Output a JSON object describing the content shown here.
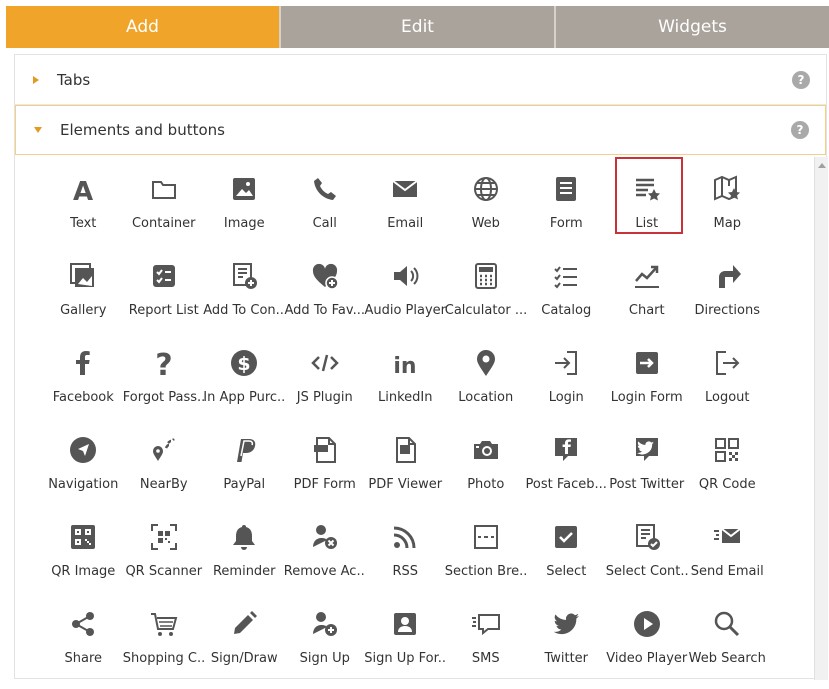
{
  "tabs": [
    {
      "label": "Add",
      "active": true
    },
    {
      "label": "Edit",
      "active": false
    },
    {
      "label": "Widgets",
      "active": false
    }
  ],
  "sections": {
    "tabs": {
      "label": "Tabs",
      "help": "?"
    },
    "elements": {
      "label": "Elements and buttons",
      "help": "?"
    }
  },
  "colors": {
    "accent": "#f0a52a",
    "icon": "#555555",
    "highlight": "#c8323a"
  },
  "items": [
    {
      "label": "Text",
      "icon": "text-icon"
    },
    {
      "label": "Container",
      "icon": "folder-icon"
    },
    {
      "label": "Image",
      "icon": "image-icon"
    },
    {
      "label": "Call",
      "icon": "phone-icon"
    },
    {
      "label": "Email",
      "icon": "envelope-icon"
    },
    {
      "label": "Web",
      "icon": "globe-icon"
    },
    {
      "label": "Form",
      "icon": "form-icon"
    },
    {
      "label": "List",
      "icon": "list-star-icon",
      "selected": true
    },
    {
      "label": "Map",
      "icon": "map-star-icon"
    },
    {
      "label": "Gallery",
      "icon": "gallery-icon"
    },
    {
      "label": "Report List",
      "icon": "report-list-icon"
    },
    {
      "label": "Add To Con...",
      "icon": "add-to-contacts-icon"
    },
    {
      "label": "Add To Fav...",
      "icon": "add-to-favorites-icon"
    },
    {
      "label": "Audio Player",
      "icon": "speaker-icon"
    },
    {
      "label": "Calculator ...",
      "icon": "calculator-icon"
    },
    {
      "label": "Catalog",
      "icon": "catalog-icon"
    },
    {
      "label": "Chart",
      "icon": "chart-icon"
    },
    {
      "label": "Directions",
      "icon": "directions-icon"
    },
    {
      "label": "Facebook",
      "icon": "facebook-icon"
    },
    {
      "label": "Forgot Pass...",
      "icon": "question-icon"
    },
    {
      "label": "In App Purc...",
      "icon": "dollar-icon"
    },
    {
      "label": "JS Plugin",
      "icon": "code-icon"
    },
    {
      "label": "LinkedIn",
      "icon": "linkedin-icon"
    },
    {
      "label": "Location",
      "icon": "location-pin-icon"
    },
    {
      "label": "Login",
      "icon": "login-icon"
    },
    {
      "label": "Login Form",
      "icon": "login-form-icon"
    },
    {
      "label": "Logout",
      "icon": "logout-icon"
    },
    {
      "label": "Navigation",
      "icon": "navigation-icon"
    },
    {
      "label": "NearBy",
      "icon": "nearby-icon"
    },
    {
      "label": "PayPal",
      "icon": "paypal-icon"
    },
    {
      "label": "PDF Form",
      "icon": "pdf-form-icon"
    },
    {
      "label": "PDF Viewer",
      "icon": "pdf-viewer-icon"
    },
    {
      "label": "Photo",
      "icon": "camera-icon"
    },
    {
      "label": "Post Faceb...",
      "icon": "post-facebook-icon"
    },
    {
      "label": "Post Twitter",
      "icon": "post-twitter-icon"
    },
    {
      "label": "QR Code",
      "icon": "qr-code-icon"
    },
    {
      "label": "QR Image",
      "icon": "qr-image-icon"
    },
    {
      "label": "QR Scanner",
      "icon": "qr-scanner-icon"
    },
    {
      "label": "Reminder",
      "icon": "bell-icon"
    },
    {
      "label": "Remove Ac...",
      "icon": "remove-account-icon"
    },
    {
      "label": "RSS",
      "icon": "rss-icon"
    },
    {
      "label": "Section Bre...",
      "icon": "section-break-icon"
    },
    {
      "label": "Select",
      "icon": "checkbox-icon"
    },
    {
      "label": "Select Cont...",
      "icon": "select-contact-icon"
    },
    {
      "label": "Send Email",
      "icon": "send-email-icon"
    },
    {
      "label": "Share",
      "icon": "share-icon"
    },
    {
      "label": "Shopping C...",
      "icon": "shopping-cart-icon"
    },
    {
      "label": "Sign/Draw",
      "icon": "pencil-icon"
    },
    {
      "label": "Sign Up",
      "icon": "sign-up-icon"
    },
    {
      "label": "Sign Up For...",
      "icon": "sign-up-form-icon"
    },
    {
      "label": "SMS",
      "icon": "sms-icon"
    },
    {
      "label": "Twitter",
      "icon": "twitter-icon"
    },
    {
      "label": "Video Player",
      "icon": "play-icon"
    },
    {
      "label": "Web Search",
      "icon": "magnifier-icon"
    }
  ]
}
